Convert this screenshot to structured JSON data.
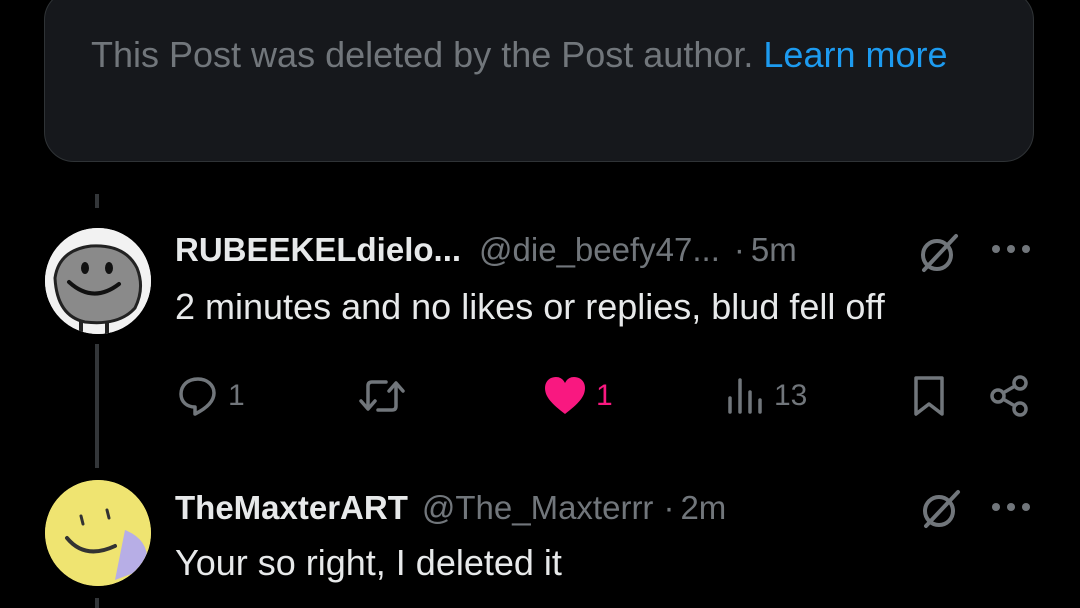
{
  "deleted_notice": {
    "text": "This Post was deleted by the Post author.",
    "link": "Learn more"
  },
  "post1": {
    "display_name": "RUBEEKELdielo...",
    "handle": "@die_beefy47...",
    "separator": "·",
    "time": "5m",
    "text": "2 minutes and no likes or replies, blud fell off",
    "actions": {
      "replies": "1",
      "reposts": "",
      "likes": "1",
      "views": "13"
    },
    "liked": true
  },
  "post2": {
    "display_name": "TheMaxterART",
    "handle": "@The_Maxterrr",
    "separator": "·",
    "time": "2m",
    "text": "Your so right, I deleted it"
  },
  "colors": {
    "background": "#000000",
    "card": "#16181c",
    "primary_text": "#e7e9ea",
    "secondary_text": "#71767b",
    "link": "#1d9bf0",
    "like": "#f91880"
  },
  "icons": [
    "grok-icon",
    "more-icon",
    "reply-icon",
    "repost-icon",
    "heart-icon",
    "views-icon",
    "bookmark-icon",
    "share-icon"
  ]
}
